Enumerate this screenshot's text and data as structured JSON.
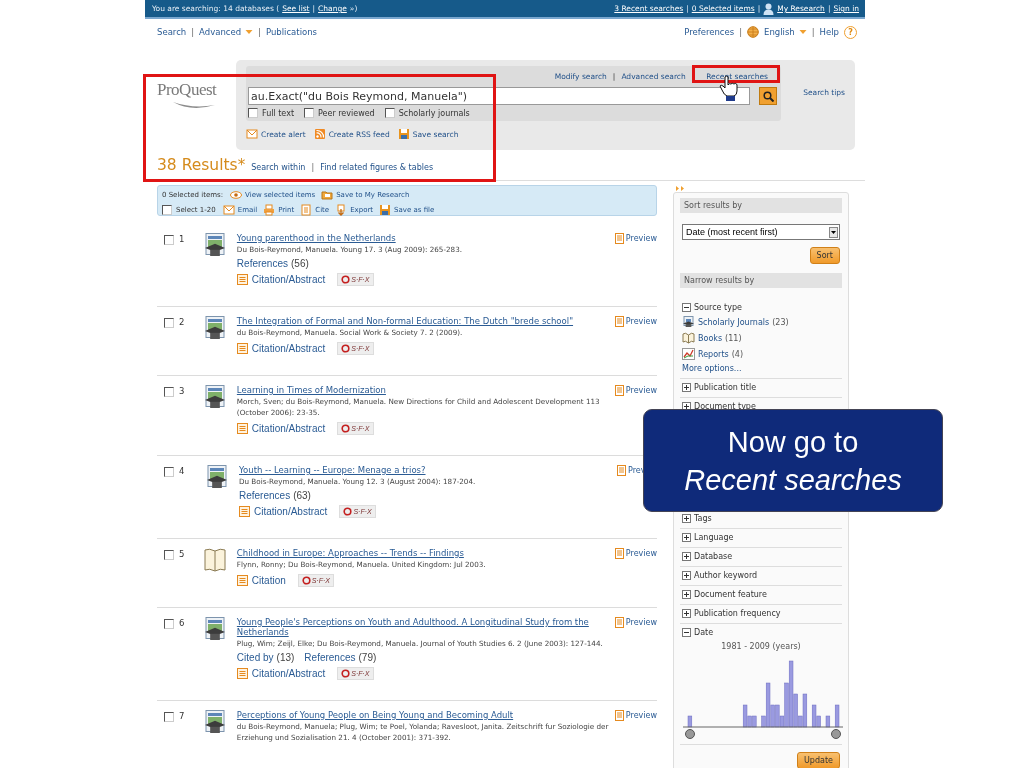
{
  "top_bar": {
    "prefix": "You are searching: 14 databases (",
    "links": [
      "See list",
      "Change"
    ],
    "separator": "|",
    "suffix": "»)",
    "right_links": [
      {
        "label": "3 Recent searches",
        "kind": "plain"
      },
      {
        "label": "0 Selected items",
        "kind": "plain"
      },
      {
        "label": "My Research",
        "kind": "user"
      },
      {
        "label": "Sign in",
        "kind": "plain"
      }
    ]
  },
  "nav": {
    "separator": "|",
    "left": [
      {
        "label": "Search",
        "dropdown": false
      },
      {
        "label": "Advanced",
        "dropdown": true
      },
      {
        "label": "Publications",
        "dropdown": false
      }
    ],
    "right": [
      {
        "label": "Preferences",
        "kind": "plain",
        "dropdown": false
      },
      {
        "label": "English",
        "kind": "globe",
        "dropdown": true
      },
      {
        "label": "Help",
        "kind": "help",
        "glyph": "?",
        "dropdown": false
      }
    ]
  },
  "logo": "ProQuest",
  "search": {
    "links": [
      "Modify search",
      "Advanced search",
      "Recent searches"
    ],
    "separator": "|",
    "value": "au.Exact(\"du Bois Reymond, Manuela\")",
    "tips": "Search tips",
    "checkboxes": [
      {
        "label": "Full text",
        "checked": false
      },
      {
        "label": "Peer reviewed",
        "checked": false
      },
      {
        "label": "Scholarly journals",
        "checked": false
      }
    ],
    "actions": [
      {
        "label": "Create alert",
        "kind": "mail"
      },
      {
        "label": "Create RSS feed",
        "kind": "rss"
      },
      {
        "label": "Save search",
        "kind": "save"
      }
    ]
  },
  "results_header": {
    "count": "38 Results",
    "mark": "*",
    "separator": "|",
    "links": [
      "Search within",
      "Find related figures & tables"
    ]
  },
  "selection_bar": {
    "count": "0 Selected items:",
    "links": [
      {
        "label": "View selected items",
        "kind": "eye"
      },
      {
        "label": "Save to My Research",
        "kind": "folder"
      }
    ],
    "select_all": {
      "label": "Select 1-20",
      "checked": false
    },
    "actions": [
      {
        "label": "Email",
        "kind": "mail"
      },
      {
        "label": "Print",
        "kind": "print"
      },
      {
        "label": "Cite",
        "kind": "cite"
      },
      {
        "label": "Export",
        "kind": "export"
      },
      {
        "label": "Save as file",
        "kind": "save"
      }
    ]
  },
  "results": [
    {
      "number": "1",
      "checked": false,
      "kind": "journal",
      "title": "Young parenthood in the Netherlands",
      "citation": "Du Bois-Reymond, Manuela. Young 17. 3  (Aug 2009): 265-283.",
      "links": [
        {
          "label": "References",
          "count": "(56)"
        }
      ],
      "access": "Citation/Abstract",
      "resolver": "S·F·X",
      "preview": "Preview"
    },
    {
      "number": "2",
      "checked": false,
      "kind": "journal",
      "title": "The Integration of Formal and Non-formal Education: The Dutch \"brede school\"",
      "citation": "du Bois-Reymond, Manuela. Social Work & Society 7. 2  (2009).",
      "access": "Citation/Abstract",
      "resolver": "S·F·X",
      "preview": "Preview"
    },
    {
      "number": "3",
      "checked": false,
      "kind": "journal",
      "title": "Learning in Times of Modernization",
      "citation": "Morch, Sven; du Bois-Reymond, Manuela. New Directions for Child and Adolescent Development 113  (October 2006): 23-35.",
      "access": "Citation/Abstract",
      "resolver": "S·F·X",
      "preview": "Preview"
    },
    {
      "number": "4",
      "checked": false,
      "kind": "journal",
      "title": "Youth -- Learning -- Europe: Menage a trios?",
      "citation": "Du Bois-Reymond, Manuela. Young 12. 3  (August 2004): 187-204.",
      "links": [
        {
          "label": "References",
          "count": "(63)"
        }
      ],
      "access": "Citation/Abstract",
      "resolver": "S·F·X",
      "preview": "Prev"
    },
    {
      "number": "5",
      "checked": false,
      "kind": "book",
      "title": "Childhood in Europe: Approaches -- Trends -- Findings",
      "citation": "Flynn, Ronny; Du Bois-Reymond, Manuela. United Kingdom: Jul 2003.",
      "access": "Citation",
      "resolver": "S·F·X",
      "preview": "Preview"
    },
    {
      "number": "6",
      "checked": false,
      "kind": "journal",
      "title": "Young People's Perceptions on Youth and Adulthood. A Longitudinal Study from the Netherlands",
      "citation": "Plug, Wim; Zeijl, Elke; Du Bois-Reymond, Manuela. Journal of Youth Studies 6. 2  (June 2003): 127-144.",
      "links": [
        {
          "label": "Cited by",
          "count": "(13)"
        },
        {
          "label": "References",
          "count": "(79)"
        }
      ],
      "access": "Citation/Abstract",
      "resolver": "S·F·X",
      "preview": "Preview"
    },
    {
      "number": "7",
      "checked": false,
      "kind": "journal",
      "title": "Perceptions of Young People on Being Young and Becoming Adult",
      "citation": "du Bois-Reymond, Manuela; Plug, Wim; te Poel, Yolanda; Ravesloot, Janita. Zeitschrift fur Soziologie der Erziehung und Sozialisation 21. 4  (October 2001): 371-392.",
      "preview": "Preview"
    }
  ],
  "sidebar": {
    "sort_heading": "Sort results by",
    "sort_value": "Date (most recent first)",
    "sort_button": "Sort",
    "narrow_heading": "Narrow results by",
    "facets": [
      {
        "label": "Source type",
        "expanded": true,
        "options": [
          {
            "label": "Scholarly Journals",
            "count": "(23)",
            "kind": "journal"
          },
          {
            "label": "Books",
            "count": "(11)",
            "kind": "book"
          },
          {
            "label": "Reports",
            "count": "(4)",
            "kind": "report"
          }
        ],
        "more": "More options..."
      },
      {
        "label": "Publication title",
        "expanded": false
      },
      {
        "label": "Document type",
        "expanded": false
      },
      {
        "label": "Tags",
        "expanded": false
      },
      {
        "label": "Language",
        "expanded": false
      },
      {
        "label": "Database",
        "expanded": false
      },
      {
        "label": "Author keyword",
        "expanded": false
      },
      {
        "label": "Document feature",
        "expanded": false
      },
      {
        "label": "Publication frequency",
        "expanded": false
      },
      {
        "label": "Date",
        "expanded": true,
        "range": "1981 - 2009 (years)"
      }
    ],
    "update_button": "Update"
  },
  "callout": {
    "line1": "Now go to",
    "line2": "Recent searches"
  }
}
